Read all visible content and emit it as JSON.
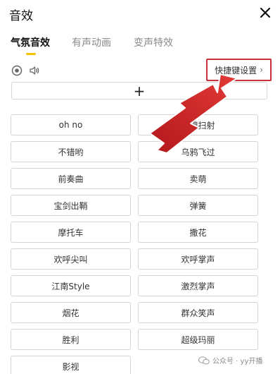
{
  "window": {
    "title": "音效"
  },
  "tabs": [
    {
      "label": "气氛音效",
      "active": true
    },
    {
      "label": "有声动画",
      "active": false
    },
    {
      "label": "变声特效",
      "active": false
    }
  ],
  "toolbar": {
    "icons": [
      "record-icon",
      "volume-icon"
    ],
    "shortcut_label": "快捷键设置",
    "shortcut_chevron": "›"
  },
  "add_bar": {
    "label": "+"
  },
  "effects": [
    "oh no",
    "魅瞳扫射",
    "不错哟",
    "乌鸦飞过",
    "前奏曲",
    "卖萌",
    "宝剑出鞘",
    "弹簧",
    "摩托车",
    "撒花",
    "欢呼尖叫",
    "欢呼掌声",
    "江南Style",
    "激烈掌声",
    "烟花",
    "群众笑声",
    "胜利",
    "超级玛丽",
    "影视"
  ],
  "watermark": {
    "text": "公众号 · yy开播"
  },
  "colors": {
    "accent": "#f5c400",
    "highlight": "#c9303a",
    "arrow": "#d42a2a"
  }
}
